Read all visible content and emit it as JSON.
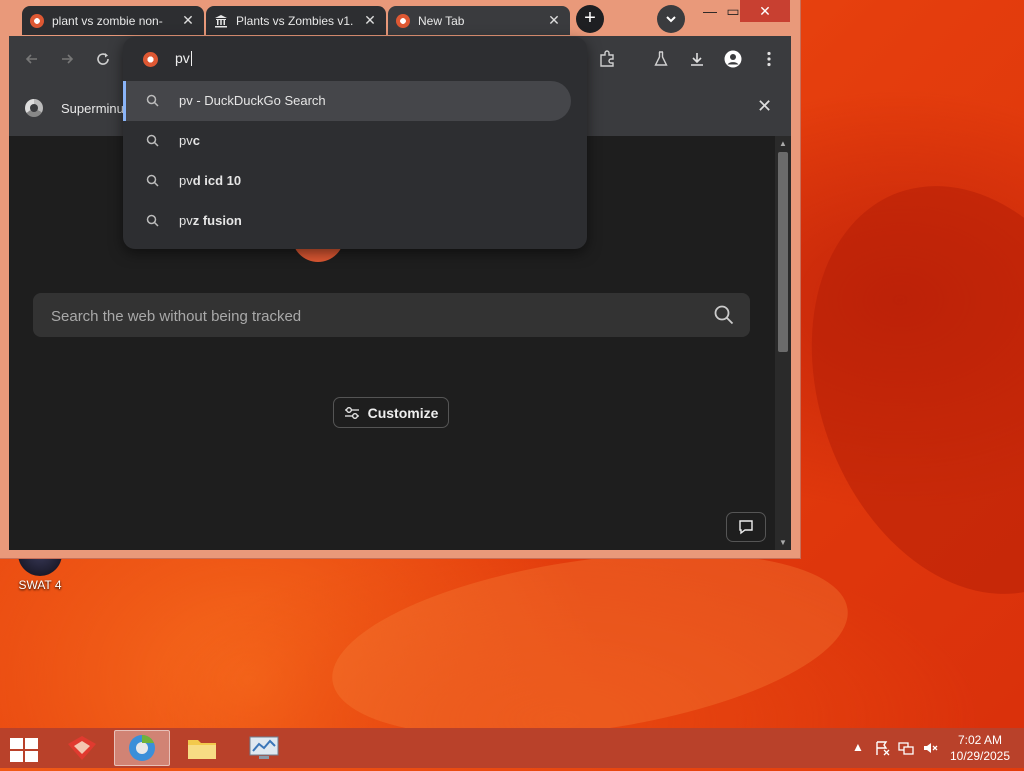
{
  "tabs": [
    {
      "title": "plant vs zombie non-",
      "icon": "duckduckgo-icon"
    },
    {
      "title": "Plants vs Zombies v1.",
      "icon": "museum-icon"
    },
    {
      "title": "New Tab",
      "icon": "duckduckgo-icon"
    }
  ],
  "tab_close_glyph": "✕",
  "bookmarks_bar": {
    "label": "Superminu"
  },
  "omnibox": {
    "typed": "pv",
    "suggestions": [
      {
        "prefix": "pv",
        "bold": "",
        "suffix": " - DuckDuckGo Search"
      },
      {
        "prefix": "pv",
        "bold": "c",
        "suffix": ""
      },
      {
        "prefix": "pv",
        "bold": "d icd 10",
        "suffix": ""
      },
      {
        "prefix": "pv",
        "bold": "z fusion",
        "suffix": ""
      }
    ]
  },
  "search": {
    "placeholder": "Search the web without being tracked"
  },
  "customize_label": "Customize",
  "desktop": {
    "icon_label": "SWAT 4"
  },
  "clock": {
    "time": "7:02 AM",
    "date": "10/29/2025"
  },
  "colors": {
    "accent": "#de5833",
    "selection": "#8ab4f8"
  }
}
